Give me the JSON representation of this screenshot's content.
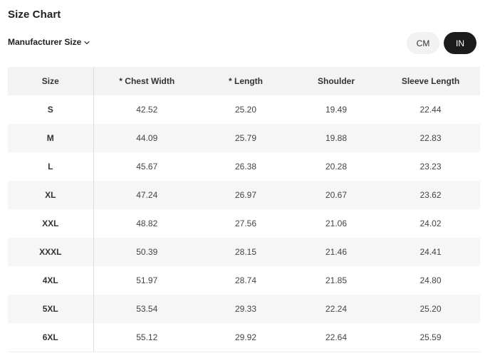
{
  "header": {
    "title": "Size Chart"
  },
  "size_selector": {
    "label": "Manufacturer Size",
    "chevron_icon": "chevron-down-icon"
  },
  "unit_toggle": {
    "cm_label": "CM",
    "in_label": "IN",
    "selected": "IN"
  },
  "table": {
    "columns": [
      "Size",
      "* Chest Width",
      "* Length",
      "Shoulder",
      "Sleeve Length"
    ],
    "rows": [
      [
        "S",
        "42.52",
        "25.20",
        "19.49",
        "22.44"
      ],
      [
        "M",
        "44.09",
        "25.79",
        "19.88",
        "22.83"
      ],
      [
        "L",
        "45.67",
        "26.38",
        "20.28",
        "23.23"
      ],
      [
        "XL",
        "47.24",
        "26.97",
        "20.67",
        "23.62"
      ],
      [
        "XXL",
        "48.82",
        "27.56",
        "21.06",
        "24.02"
      ],
      [
        "XXXL",
        "50.39",
        "28.15",
        "21.46",
        "24.41"
      ],
      [
        "4XL",
        "51.97",
        "28.74",
        "21.85",
        "24.80"
      ],
      [
        "5XL",
        "53.54",
        "29.33",
        "22.24",
        "25.20"
      ],
      [
        "6XL",
        "55.12",
        "29.92",
        "22.64",
        "25.59"
      ]
    ]
  },
  "colors": {
    "active_toggle_bg": "#1c1c1c",
    "inactive_toggle_bg": "#f2f2f2",
    "header_row_bg": "#f3f3f3",
    "striped_row_bg": "#f6f6f6"
  }
}
